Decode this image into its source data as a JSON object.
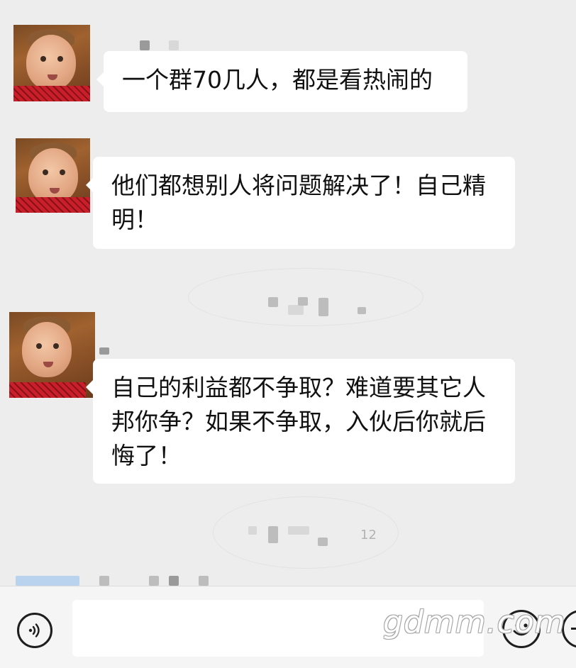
{
  "messages": [
    {
      "text": "一个群70几人，都是看热闹的",
      "sender_avatar": "child-avatar"
    },
    {
      "text": "他们都想别人将问题解决了！自己精明！",
      "sender_avatar": "child-avatar"
    },
    {
      "text": "自己的利益都不争取？难道要其它人邦你争？如果不争取，入伙后你就后悔了！",
      "sender_avatar": "child-avatar"
    }
  ],
  "timestamp_fragment": "12",
  "input_bar": {
    "voice_icon": "voice-icon",
    "emoji_icon": "emoji-icon",
    "plus_icon": "plus-icon",
    "input_value": ""
  },
  "watermark": "gdmm.com"
}
